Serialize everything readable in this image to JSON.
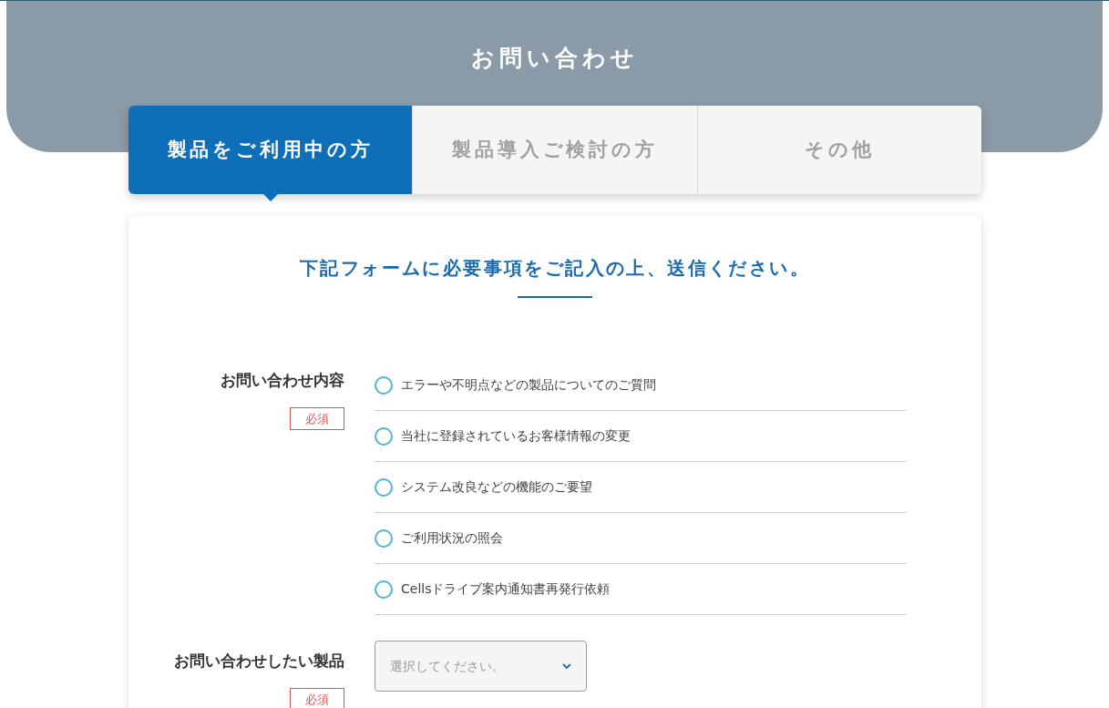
{
  "header": {
    "title": "お問い合わせ"
  },
  "tabs": [
    {
      "label": "製品をご利用中の方",
      "selected": true
    },
    {
      "label": "製品導入ご検討の方",
      "selected": false
    },
    {
      "label": "その他",
      "selected": false
    }
  ],
  "form": {
    "heading": "下記フォームに必要事項をご記入の上、送信ください。",
    "fields": [
      {
        "kind": "radio",
        "label": "お問い合わせ内容",
        "required_badge": "必須",
        "options": [
          {
            "label": "エラーや不明点などの製品についてのご質問",
            "selected": false
          },
          {
            "label": "当社に登録されているお客様情報の変更",
            "selected": false
          },
          {
            "label": "システム改良などの機能のご要望",
            "selected": false
          },
          {
            "label": "ご利用状況の照会",
            "selected": false
          },
          {
            "label": "Cellsドライブ案内通知書再発行依頼",
            "selected": false
          }
        ]
      },
      {
        "kind": "select",
        "label": "お問い合わせしたい製品",
        "required_badge": "必須",
        "placeholder": "選択してください。"
      }
    ]
  }
}
